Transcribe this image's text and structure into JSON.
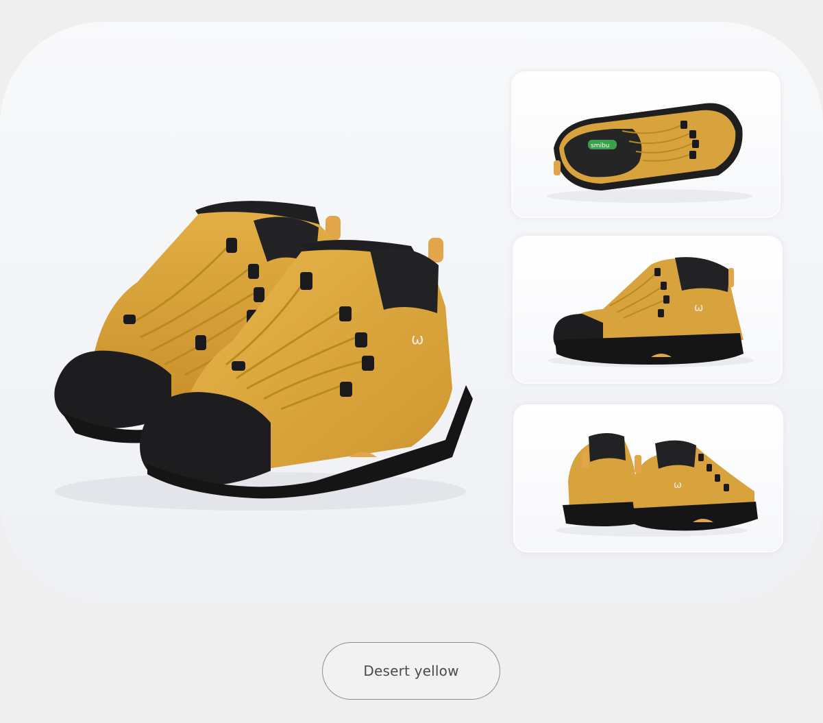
{
  "colors": {
    "page_background": "#efefef",
    "card_background": "#f5f6f9",
    "boot_leather": "#d9a43a",
    "boot_sole": "#1e1e1f",
    "lace": "#b88a1f",
    "pill_border": "#8d8d8d",
    "pill_text": "#4a4a4a"
  },
  "gallery": {
    "main_image": {
      "subject": "pair of yellow hiking boots, front three-quarter view"
    },
    "thumbnails": [
      {
        "subject": "top-down view of single boot",
        "insole_logo_text": "smibu"
      },
      {
        "subject": "side view of single boot"
      },
      {
        "subject": "rear view of pair of boots"
      }
    ]
  },
  "color_option": {
    "label": "Desert yellow"
  }
}
